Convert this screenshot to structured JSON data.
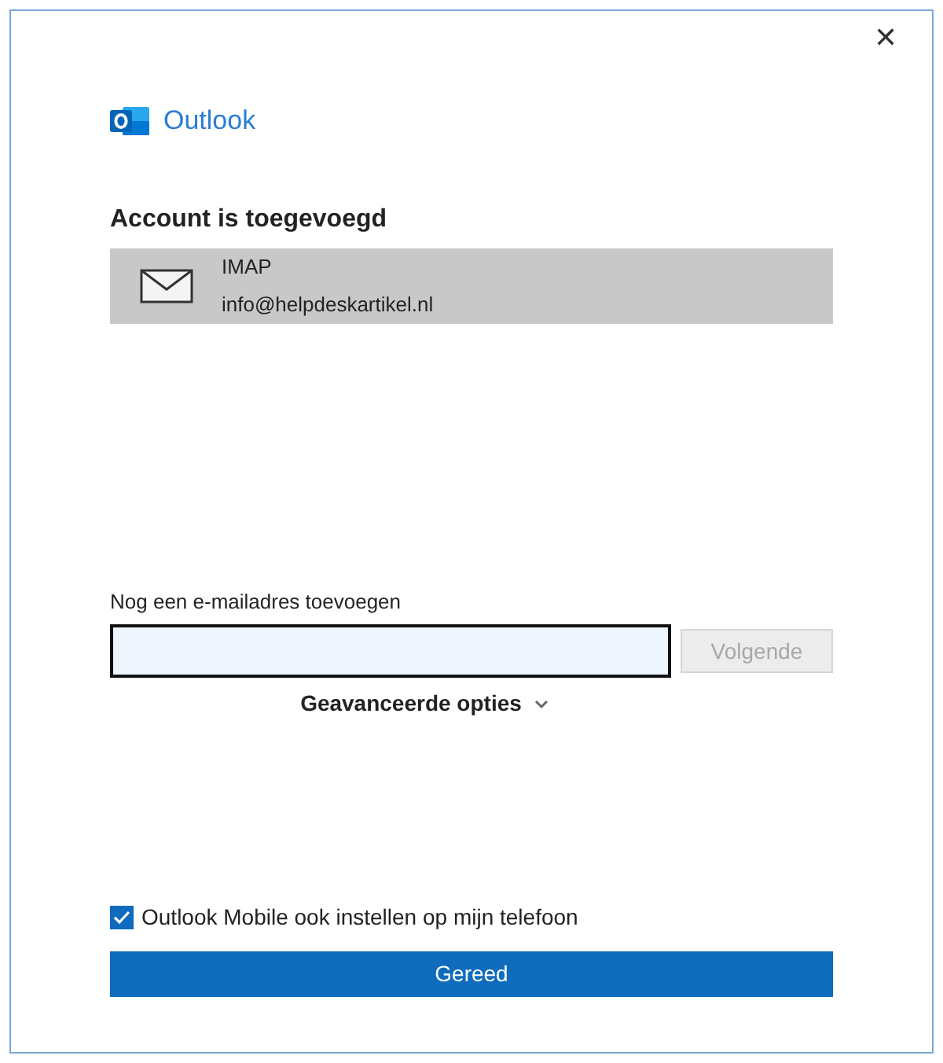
{
  "window": {
    "close": "✕"
  },
  "brand": {
    "name": "Outlook"
  },
  "heading": "Account is toegevoegd",
  "account": {
    "type": "IMAP",
    "email": "info@helpdeskartikel.nl"
  },
  "add_email": {
    "label": "Nog een e-mailadres toevoegen",
    "next_button": {
      "label": "Volgende",
      "disabled": true
    }
  },
  "advanced": {
    "label": "Geavanceerde opties",
    "expanded": false
  },
  "mobile_checkbox": {
    "label": "Outlook Mobile ook instellen op mijn telefoon",
    "checked": true
  },
  "done_button": "Gereed"
}
